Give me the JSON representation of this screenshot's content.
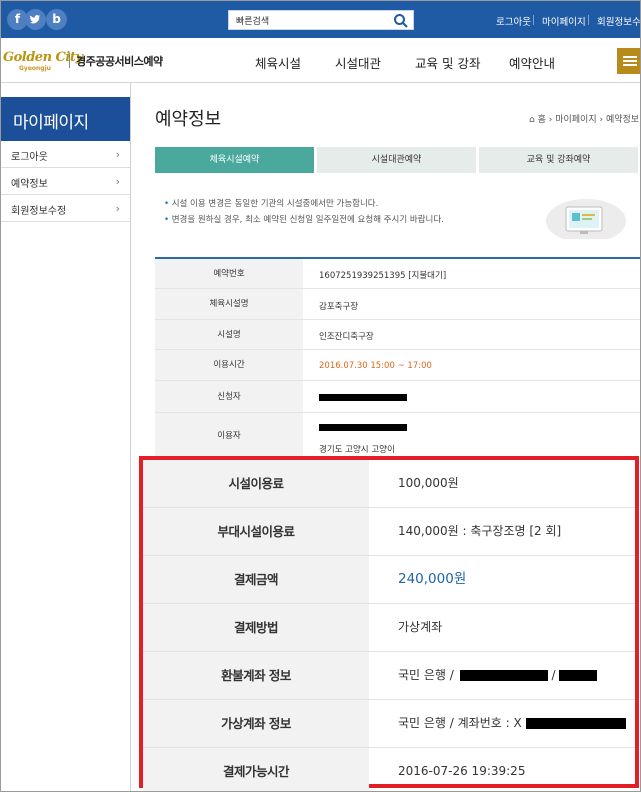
{
  "social": {
    "facebook": "f",
    "twitter": "t",
    "blog": "b"
  },
  "search": {
    "placeholder": "빠른검색"
  },
  "topnav": {
    "logout": "로그아웃",
    "mypage": "마이페이지",
    "member": "회원정보수정"
  },
  "logo": {
    "brand": "Golden City",
    "sub": "Gyeongju",
    "name": "경주공공서비스예약"
  },
  "mainnav": [
    "체육시설",
    "시설대관",
    "교육 및 강좌",
    "예약안내"
  ],
  "sidebar": {
    "title": "마이페이지",
    "items": [
      {
        "label": "로그아웃"
      },
      {
        "label": "예약정보"
      },
      {
        "label": "회원정보수정"
      }
    ]
  },
  "page": {
    "title": "예약정보"
  },
  "breadcrumb": {
    "home": "홈",
    "mypage": "마이페이지",
    "current": "예약정보"
  },
  "tabs": [
    "체육시설예약",
    "시설대관예약",
    "교육 및 강좌예약"
  ],
  "notices": [
    "시설 이용 변경은 동일한 기관의 시설중에서만 가능합니다.",
    "변경을 원하실 경우, 최소 예약된 신청일 일주일전에 요청해 주시기 바랍니다."
  ],
  "info": {
    "rows": [
      {
        "label": "예약번호",
        "value": "1607251939251395 [지불대기]"
      },
      {
        "label": "체육시설명",
        "value": "감포축구장"
      },
      {
        "label": "시설명",
        "value": "인조잔디축구장"
      },
      {
        "label": "이용시간",
        "value": "2016.07.30 15:00 ~ 17:00"
      },
      {
        "label": "신청자",
        "value": ""
      },
      {
        "label": "이용자",
        "value": "경기도 고양시 고양이"
      }
    ]
  },
  "payment": {
    "rows": [
      {
        "label": "시설이용료",
        "value": "100,000원"
      },
      {
        "label": "부대시설이용료",
        "value": "140,000원 : 축구장조명 [2 회]"
      },
      {
        "label": "결제금액",
        "value": "240,000원"
      },
      {
        "label": "결제방법",
        "value": "가상계좌"
      },
      {
        "label": "환불계좌 정보",
        "value": "국민 은행 /",
        "value_suffix": "/"
      },
      {
        "label": "가상계좌 정보",
        "value": "국민 은행 / 계좌번호 : X"
      },
      {
        "label": "결제가능시간",
        "value": "2016-07-26 19:39:25"
      }
    ]
  },
  "colors": {
    "topbar": "#1f5aa4",
    "sidebar_title": "#1b4f9a",
    "tab_active": "#4aa89c",
    "highlight": "#e21f26",
    "amount": "#1f63ad",
    "time": "#e2661e",
    "menu": "#b88a1a"
  }
}
